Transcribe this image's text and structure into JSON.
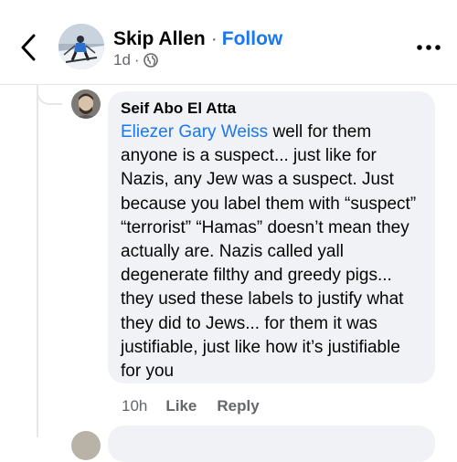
{
  "header": {
    "author": "Skip Allen",
    "separator": "·",
    "follow_label": "Follow",
    "time": "1d",
    "meta_separator": "·",
    "privacy_icon": "globe-icon",
    "back_icon": "chevron-left-icon",
    "more_icon": "more-horizontal-icon"
  },
  "reply": {
    "author": "Seif Abo El Atta",
    "mention": "Eliezer Gary Weiss",
    "text": " well for them anyone is a suspect... just like for Nazis, any Jew was a suspect. Just because you label them with “suspect” “terrorist” “Hamas” doesn’t mean they actually are. Nazis called yall degenerate filthy and greedy pigs... they used these labels to justify what they did to Jews... for them it was justifiable, just like how it’s justifiable for you",
    "time": "10h",
    "like_label": "Like",
    "reply_label": "Reply"
  },
  "colors": {
    "accent": "#1877f2",
    "secondary_text": "#65676b",
    "bubble": "#f0f2f5"
  }
}
